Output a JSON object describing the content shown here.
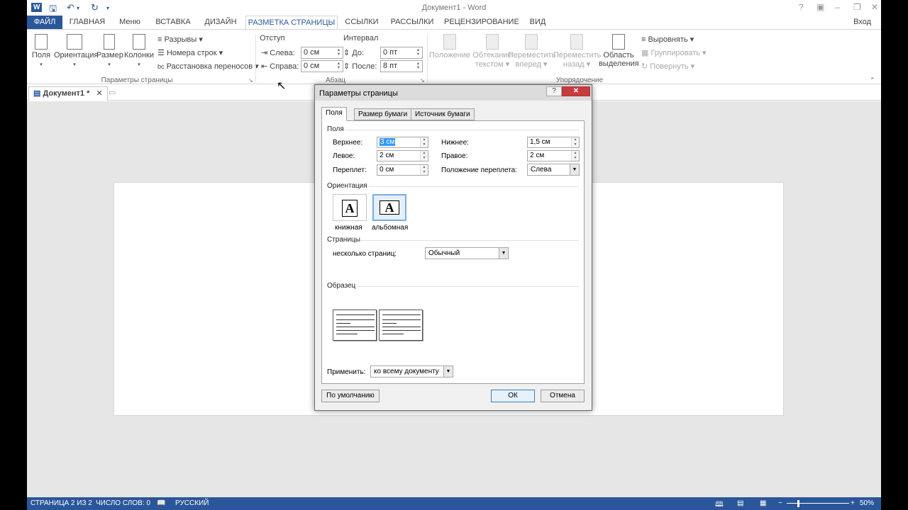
{
  "app": {
    "title": "Документ1 - Word",
    "login": "Вход",
    "qa_icons": [
      "word-logo-icon",
      "save-icon",
      "undo-icon",
      "redo-icon",
      "customize-quick-access-icon"
    ]
  },
  "tabs": [
    "ФАЙЛ",
    "ГЛАВНАЯ",
    "Меню",
    "ВСТАВКА",
    "ДИЗАЙН",
    "РАЗМЕТКА СТРАНИЦЫ",
    "ССЫЛКИ",
    "РАССЫЛКИ",
    "РЕЦЕНЗИРОВАНИЕ",
    "ВИД"
  ],
  "ribbon": {
    "page_setup": {
      "fields": "Поля",
      "orientation": "Ориентация",
      "size": "Размер",
      "columns": "Колонки",
      "breaks": "Разрывы",
      "line_numbers": "Номера строк",
      "hyphenation": "Расстановка переносов",
      "group": "Параметры страницы"
    },
    "paragraph": {
      "indent_title": "Отступ",
      "left_label": "Слева:",
      "left_value": "0 см",
      "right_label": "Справа:",
      "right_value": "0 см",
      "spacing_title": "Интервал",
      "before_label": "До:",
      "before_value": "0 пт",
      "after_label": "После:",
      "after_value": "8 пт",
      "group": "Абзац"
    },
    "arrange": {
      "position": [
        "Положение",
        "."
      ],
      "wrap": [
        "Обтекание",
        "текстом"
      ],
      "forward": [
        "Переместить",
        "вперед"
      ],
      "backward": [
        "Переместить",
        "назад"
      ],
      "selection": [
        "Область",
        "выделения"
      ],
      "align": "Выровнять",
      "group_btn": "Группировать",
      "rotate": "Повернуть",
      "group": "Упорядочение"
    }
  },
  "document": {
    "tab_label": "Документ1 *"
  },
  "status": {
    "page": "СТРАНИЦА 2 ИЗ 2",
    "words": "ЧИСЛО СЛОВ: 0",
    "lang": "РУССКИЙ",
    "zoom": "50%"
  },
  "dialog": {
    "title": "Параметры страницы",
    "tabs": [
      "Поля",
      "Размер бумаги",
      "Источник бумаги"
    ],
    "margins_title": "Поля",
    "top_label": "Верхнее:",
    "top_value": "3 см",
    "bottom_label": "Нижнее:",
    "bottom_value": "1,5 см",
    "left_label": "Левое:",
    "left_value": "2 см",
    "right_label": "Правое:",
    "right_value": "2 см",
    "gutter_label": "Переплет:",
    "gutter_value": "0 см",
    "gutter_pos_label": "Положение переплета:",
    "gutter_pos_value": "Слева",
    "orientation_title": "Ориентация",
    "portrait": "книжная",
    "landscape": "альбомная",
    "pages_title": "Страницы",
    "multiple_label": "несколько страниц:",
    "multiple_value": "Обычный",
    "preview_title": "Образец",
    "apply_label": "Применить:",
    "apply_value": "ко всему документу",
    "default_btn": "По умолчанию",
    "ok_btn": "ОК",
    "cancel_btn": "Отмена"
  }
}
